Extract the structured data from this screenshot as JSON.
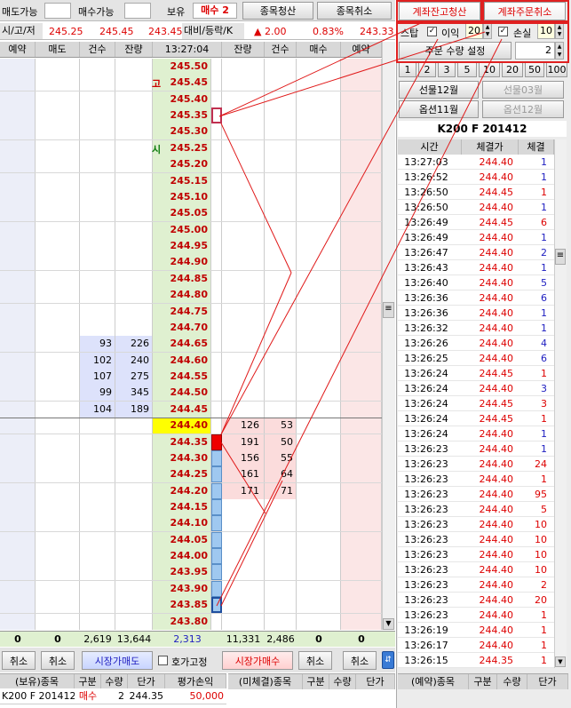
{
  "top": {
    "sell_avail_label": "매도가능",
    "sell_avail_value": "",
    "buy_avail_label": "매수가능",
    "buy_avail_value": "",
    "hold_label": "보유",
    "hold_value": "매수 2",
    "close_item_btn": "종목청산",
    "cancel_item_btn": "종목취소",
    "acct_close_btn": "계좌잔고청산",
    "acct_cancel_btn": "계좌주문취소"
  },
  "info": {
    "label": "시/고/저",
    "open": "245.25",
    "high": "245.45",
    "low": "243.45",
    "label2": "대비/등락/K",
    "change": "▲ 2.00",
    "rate": "0.83%",
    "k": "243.33"
  },
  "ladder_headers": [
    "예약",
    "매도",
    "건수",
    "잔량",
    "13:27:04",
    "잔량",
    "건수",
    "매수",
    "예약"
  ],
  "price_tags": {
    "high": "고",
    "open": "시"
  },
  "prices": [
    "245.50",
    "245.45",
    "245.40",
    "245.35",
    "245.30",
    "245.25",
    "245.20",
    "245.15",
    "245.10",
    "245.05",
    "245.00",
    "244.95",
    "244.90",
    "244.85",
    "244.80",
    "244.75",
    "244.70",
    "244.65",
    "244.60",
    "244.55",
    "244.50",
    "244.45",
    "244.40",
    "244.35",
    "244.30",
    "244.25",
    "244.20",
    "244.15",
    "244.10",
    "244.05",
    "244.00",
    "243.95",
    "243.90",
    "243.85",
    "243.80"
  ],
  "ask_orders": [
    {
      "cnt": "93",
      "qty": "226"
    },
    {
      "cnt": "102",
      "qty": "240"
    },
    {
      "cnt": "107",
      "qty": "275"
    },
    {
      "cnt": "99",
      "qty": "345"
    },
    {
      "cnt": "104",
      "qty": "189"
    }
  ],
  "bid_orders": [
    {
      "qty": "126",
      "cnt": "53"
    },
    {
      "qty": "191",
      "cnt": "50"
    },
    {
      "qty": "156",
      "cnt": "55"
    },
    {
      "qty": "161",
      "cnt": "64"
    },
    {
      "qty": "171",
      "cnt": "71"
    }
  ],
  "totals": {
    "sell_reserve": "0",
    "sell": "0",
    "ask_cnt": "2,619",
    "ask_qty": "13,644",
    "diff": "2,313",
    "bid_qty": "11,331",
    "bid_cnt": "2,486",
    "buy": "0",
    "buy_reserve": "0"
  },
  "bottom_buttons": {
    "cancel1": "취소",
    "cancel2": "취소",
    "market_sell": "시장가매도",
    "quote_fix": "호가고정",
    "market_buy": "시장가매수",
    "cancel3": "취소",
    "cancel4": "취소"
  },
  "pos_headers": [
    "(보유)종목",
    "구분",
    "수량",
    "단가",
    "평가손익"
  ],
  "position": {
    "item": "K200 F 201412",
    "side": "매수",
    "qty": "2",
    "price": "244.35",
    "pnl": "50,000"
  },
  "unfilled_headers": [
    "(미체결)종목",
    "구분",
    "수량",
    "단가"
  ],
  "reserve_headers": [
    "(예약)종목",
    "구분",
    "수량",
    "단가"
  ],
  "right": {
    "stop_label": "스탑",
    "profit_label": "이익",
    "profit_value": "20",
    "loss_label": "손실",
    "loss_value": "10",
    "order_qty_label": "주문 수량 설정",
    "order_qty_value": "2",
    "qty_buttons": [
      "1",
      "2",
      "3",
      "5",
      "10",
      "20",
      "50",
      "100"
    ],
    "fut_dec": "선물12월",
    "fut_mar": "선물03월",
    "opt_nov": "옵션11월",
    "opt_dec": "옵션12월",
    "product_title": "K200 F 201412"
  },
  "trade_headers": [
    "시간",
    "체결가",
    "체결"
  ],
  "trades": [
    {
      "t": "13:27:03",
      "p": "244.40",
      "q": "1",
      "c": "red",
      "qc": "blue"
    },
    {
      "t": "13:26:52",
      "p": "244.40",
      "q": "1",
      "c": "red",
      "qc": "blue"
    },
    {
      "t": "13:26:50",
      "p": "244.45",
      "q": "1",
      "c": "red",
      "qc": "red"
    },
    {
      "t": "13:26:50",
      "p": "244.40",
      "q": "1",
      "c": "red",
      "qc": "blue"
    },
    {
      "t": "13:26:49",
      "p": "244.45",
      "q": "6",
      "c": "red",
      "qc": "red"
    },
    {
      "t": "13:26:49",
      "p": "244.40",
      "q": "1",
      "c": "red",
      "qc": "blue"
    },
    {
      "t": "13:26:47",
      "p": "244.40",
      "q": "2",
      "c": "red",
      "qc": "blue"
    },
    {
      "t": "13:26:43",
      "p": "244.40",
      "q": "1",
      "c": "red",
      "qc": "blue"
    },
    {
      "t": "13:26:40",
      "p": "244.40",
      "q": "5",
      "c": "red",
      "qc": "blue"
    },
    {
      "t": "13:26:36",
      "p": "244.40",
      "q": "6",
      "c": "red",
      "qc": "blue"
    },
    {
      "t": "13:26:36",
      "p": "244.40",
      "q": "1",
      "c": "red",
      "qc": "blue"
    },
    {
      "t": "13:26:32",
      "p": "244.40",
      "q": "1",
      "c": "red",
      "qc": "blue"
    },
    {
      "t": "13:26:26",
      "p": "244.40",
      "q": "4",
      "c": "red",
      "qc": "blue"
    },
    {
      "t": "13:26:25",
      "p": "244.40",
      "q": "6",
      "c": "red",
      "qc": "blue"
    },
    {
      "t": "13:26:24",
      "p": "244.45",
      "q": "1",
      "c": "red",
      "qc": "red"
    },
    {
      "t": "13:26:24",
      "p": "244.40",
      "q": "3",
      "c": "red",
      "qc": "blue"
    },
    {
      "t": "13:26:24",
      "p": "244.45",
      "q": "3",
      "c": "red",
      "qc": "red"
    },
    {
      "t": "13:26:24",
      "p": "244.45",
      "q": "1",
      "c": "red",
      "qc": "red"
    },
    {
      "t": "13:26:24",
      "p": "244.40",
      "q": "1",
      "c": "red",
      "qc": "blue"
    },
    {
      "t": "13:26:23",
      "p": "244.40",
      "q": "1",
      "c": "red",
      "qc": "blue"
    },
    {
      "t": "13:26:23",
      "p": "244.40",
      "q": "24",
      "c": "red",
      "qc": "red"
    },
    {
      "t": "13:26:23",
      "p": "244.40",
      "q": "1",
      "c": "red",
      "qc": "red"
    },
    {
      "t": "13:26:23",
      "p": "244.40",
      "q": "95",
      "c": "red",
      "qc": "red"
    },
    {
      "t": "13:26:23",
      "p": "244.40",
      "q": "5",
      "c": "red",
      "qc": "red"
    },
    {
      "t": "13:26:23",
      "p": "244.40",
      "q": "10",
      "c": "red",
      "qc": "red"
    },
    {
      "t": "13:26:23",
      "p": "244.40",
      "q": "10",
      "c": "red",
      "qc": "red"
    },
    {
      "t": "13:26:23",
      "p": "244.40",
      "q": "10",
      "c": "red",
      "qc": "red"
    },
    {
      "t": "13:26:23",
      "p": "244.40",
      "q": "10",
      "c": "red",
      "qc": "red"
    },
    {
      "t": "13:26:23",
      "p": "244.40",
      "q": "2",
      "c": "red",
      "qc": "red"
    },
    {
      "t": "13:26:23",
      "p": "244.40",
      "q": "20",
      "c": "red",
      "qc": "red"
    },
    {
      "t": "13:26:23",
      "p": "244.40",
      "q": "1",
      "c": "red",
      "qc": "red"
    },
    {
      "t": "13:26:19",
      "p": "244.40",
      "q": "1",
      "c": "red",
      "qc": "red"
    },
    {
      "t": "13:26:17",
      "p": "244.40",
      "q": "1",
      "c": "red",
      "qc": "red"
    },
    {
      "t": "13:26:15",
      "p": "244.35",
      "q": "1",
      "c": "red",
      "qc": "red"
    }
  ]
}
